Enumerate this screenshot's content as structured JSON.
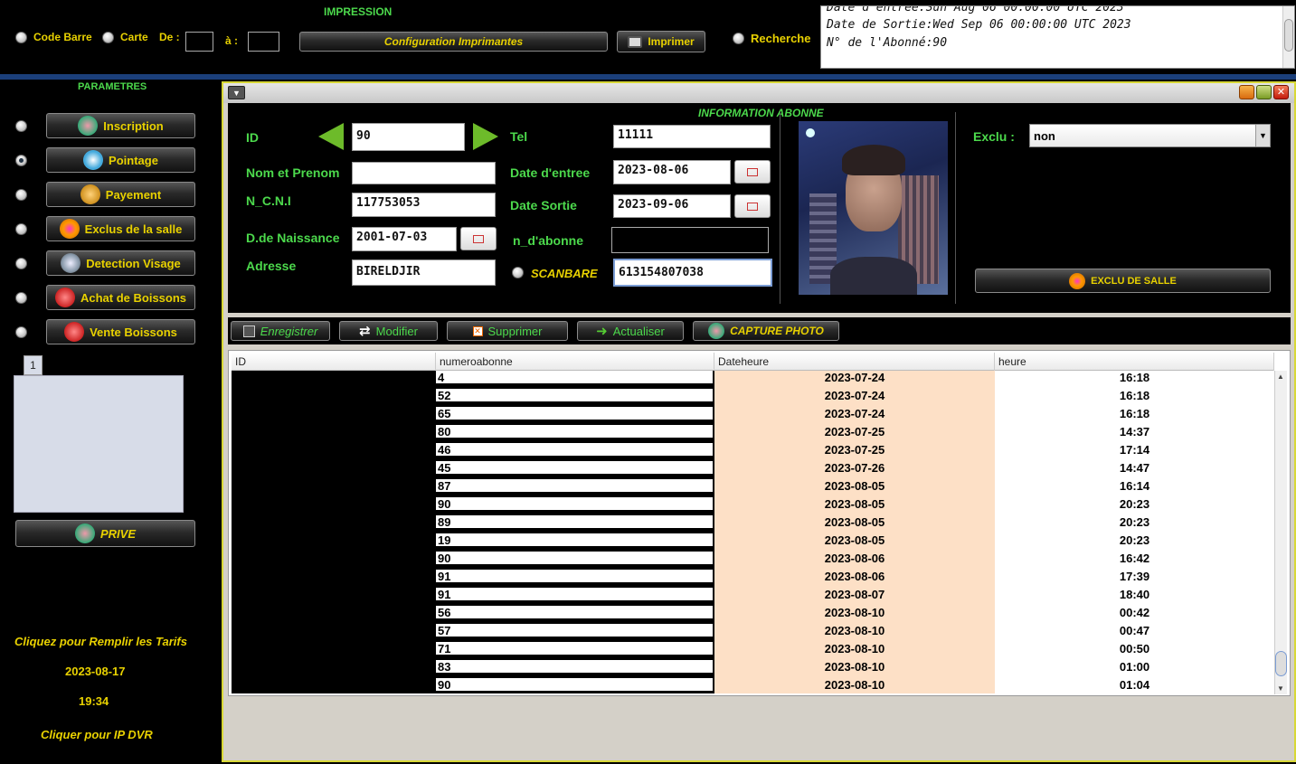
{
  "top": {
    "impression_label": "IMPRESSION",
    "code_barre": "Code Barre",
    "carte": "Carte",
    "de": "De :",
    "a": "à :",
    "config_btn": "Configuration Imprimantes",
    "imprimer_btn": "Imprimer",
    "recherche": "Recherche",
    "info_lines": [
      "Date d'entrée:Sun Aug 06 00:00:00 UTC 2023",
      "Date de Sortie:Wed Sep 06 00:00:00 UTC 2023",
      "N° de l'Abonné:90"
    ]
  },
  "sidebar": {
    "title": "PARAMETRES",
    "items": [
      {
        "label": "Inscription",
        "icon": "users-icon",
        "selected": false
      },
      {
        "label": "Pointage",
        "icon": "user-circle-icon",
        "selected": true
      },
      {
        "label": "Payement",
        "icon": "coins-icon",
        "selected": false
      },
      {
        "label": "Exclus de la salle",
        "icon": "user-excluded-icon",
        "selected": false
      },
      {
        "label": "Detection Visage",
        "icon": "magnifier-icon",
        "selected": false
      },
      {
        "label": "Achat de Boissons",
        "icon": "cart-icon",
        "selected": false
      },
      {
        "label": "Vente  Boissons",
        "icon": "cart-icon",
        "selected": false
      }
    ],
    "tab_label": "1",
    "prive_btn": "PRIVE",
    "tarifs_link": "Cliquez pour Remplir les Tarifs",
    "date": "2023-08-17",
    "time": "19:34",
    "dvr_link": "Cliquer pour IP DVR"
  },
  "form": {
    "title": "INFORMATION ABONNE",
    "id_label": "ID",
    "id_value": "90",
    "tel_label": "Tel",
    "tel_value": "11111",
    "nom_label": "Nom et Prenom",
    "nom_value": "",
    "date_entree_label": "Date d'entree",
    "date_entree_value": "2023-08-06",
    "ncni_label": "N_C.N.I",
    "ncni_value": "117753053",
    "date_sortie_label": "Date Sortie",
    "date_sortie_value": "2023-09-06",
    "naissance_label": "D.de Naissance",
    "naissance_value": "2001-07-03",
    "n_abonne_label": "n_d'abonne",
    "n_abonne_value": "",
    "adresse_label": "Adresse",
    "adresse_value": "BIRELDJIR",
    "scanbare_label": "SCANBARE",
    "scanbare_value": "613154807038",
    "exclu_label": "Exclu :",
    "exclu_value": "non",
    "exclu_btn": "EXCLU DE SALLE"
  },
  "actions": {
    "enregistrer": "Enregistrer",
    "modifier": "Modifier",
    "supprimer": "Supprimer",
    "actualiser": "Actualiser",
    "capture": "CAPTURE PHOTO"
  },
  "table": {
    "columns": [
      "ID",
      "numeroabonne",
      "Dateheure",
      "heure"
    ],
    "rows": [
      [
        "",
        "4",
        "2023-07-24",
        "16:18"
      ],
      [
        "",
        "52",
        "2023-07-24",
        "16:18"
      ],
      [
        "",
        "65",
        "2023-07-24",
        "16:18"
      ],
      [
        "",
        "80",
        "2023-07-25",
        "14:37"
      ],
      [
        "",
        "46",
        "2023-07-25",
        "17:14"
      ],
      [
        "",
        "45",
        "2023-07-26",
        "14:47"
      ],
      [
        "",
        "87",
        "2023-08-05",
        "16:14"
      ],
      [
        "",
        "90",
        "2023-08-05",
        "20:23"
      ],
      [
        "",
        "89",
        "2023-08-05",
        "20:23"
      ],
      [
        "",
        "19",
        "2023-08-05",
        "20:23"
      ],
      [
        "",
        "90",
        "2023-08-06",
        "16:42"
      ],
      [
        "",
        "91",
        "2023-08-06",
        "17:39"
      ],
      [
        "",
        "91",
        "2023-08-07",
        "18:40"
      ],
      [
        "",
        "56",
        "2023-08-10",
        "00:42"
      ],
      [
        "",
        "57",
        "2023-08-10",
        "00:47"
      ],
      [
        "",
        "71",
        "2023-08-10",
        "00:50"
      ],
      [
        "",
        "83",
        "2023-08-10",
        "01:00"
      ],
      [
        "",
        "90",
        "2023-08-10",
        "01:04"
      ]
    ]
  }
}
